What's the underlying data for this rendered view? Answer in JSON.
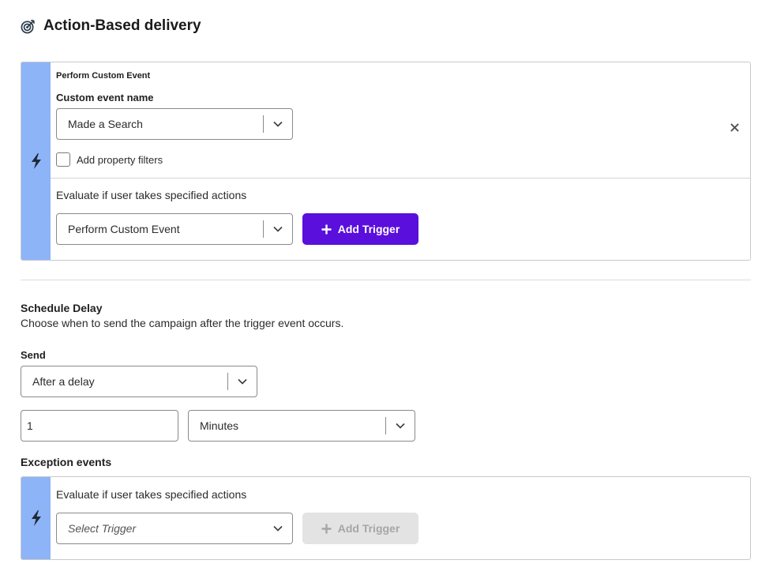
{
  "header": {
    "title": "Action-Based delivery",
    "icon": "target-icon"
  },
  "trigger_card": {
    "heading": "Perform Custom Event",
    "event_name_label": "Custom event name",
    "event_name_value": "Made a Search",
    "property_filters_label": "Add property filters",
    "property_filters_checked": false,
    "evaluate_label": "Evaluate if user takes specified actions",
    "trigger_select_value": "Perform Custom Event",
    "add_trigger_label": "Add Trigger"
  },
  "schedule": {
    "title": "Schedule Delay",
    "description": "Choose when to send the campaign after the trigger event occurs.",
    "send_label": "Send",
    "send_value": "After a delay",
    "delay_amount": "1",
    "delay_unit": "Minutes"
  },
  "exceptions": {
    "title": "Exception events",
    "evaluate_label": "Evaluate if user takes specified actions",
    "select_placeholder": "Select Trigger",
    "add_trigger_label": "Add Trigger",
    "add_trigger_disabled": true
  },
  "colors": {
    "accent": "#5b0fdc",
    "rail": "#8db4f7",
    "disabled": "#e3e3e3"
  }
}
